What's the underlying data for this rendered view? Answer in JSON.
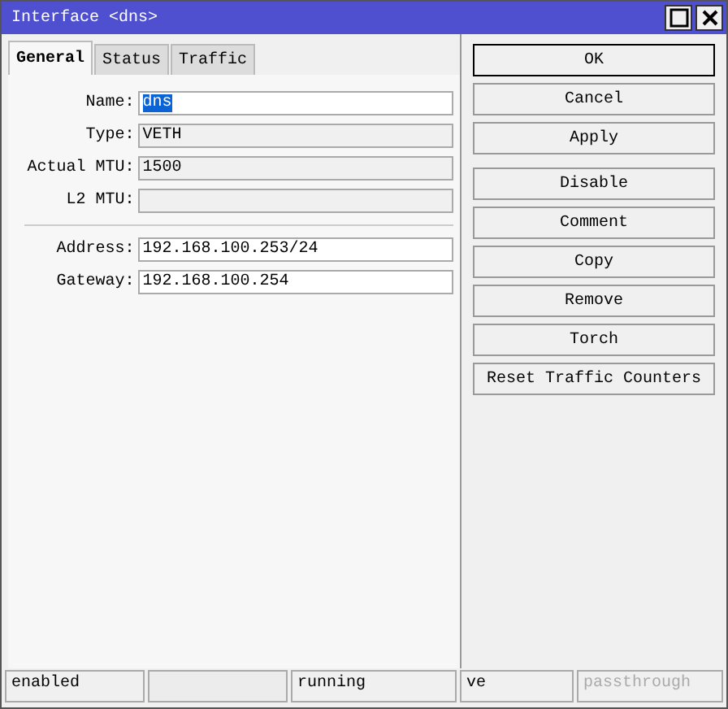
{
  "window": {
    "title": "Interface <dns>"
  },
  "tabs": [
    {
      "label": "General",
      "selected": true
    },
    {
      "label": "Status",
      "selected": false
    },
    {
      "label": "Traffic",
      "selected": false
    }
  ],
  "fields_top": [
    {
      "label": "Name:",
      "value": "dns",
      "editable": true,
      "text_selected": true
    },
    {
      "label": "Type:",
      "value": "VETH",
      "editable": false,
      "text_selected": false
    },
    {
      "label": "Actual MTU:",
      "value": "1500",
      "editable": false,
      "text_selected": false
    },
    {
      "label": "L2 MTU:",
      "editable": false
    }
  ],
  "fields_bottom": [
    {
      "label": "Address:",
      "value": "192.168.100.253/24",
      "editable": true,
      "text_selected": false
    },
    {
      "label": "Gateway:",
      "value": "192.168.100.254",
      "editable": true,
      "text_selected": false
    }
  ],
  "dialog_buttons": [
    {
      "label": "OK",
      "default": true
    },
    {
      "label": "Cancel",
      "default": false
    },
    {
      "label": "Apply",
      "default": false
    }
  ],
  "action_buttons": [
    {
      "label": "Disable"
    },
    {
      "label": "Comment"
    },
    {
      "label": "Copy"
    },
    {
      "label": "Remove"
    },
    {
      "label": "Torch"
    },
    {
      "label": "Reset Traffic Counters"
    }
  ],
  "status_bar": [
    {
      "kind": "text",
      "text": "enabled",
      "disabled": false
    },
    {
      "kind": "blank"
    },
    {
      "kind": "text",
      "text": "running",
      "disabled": false
    },
    {
      "kind": "text",
      "text": "ve",
      "disabled": false
    },
    {
      "kind": "text",
      "text": "passthrough",
      "disabled": true
    }
  ]
}
